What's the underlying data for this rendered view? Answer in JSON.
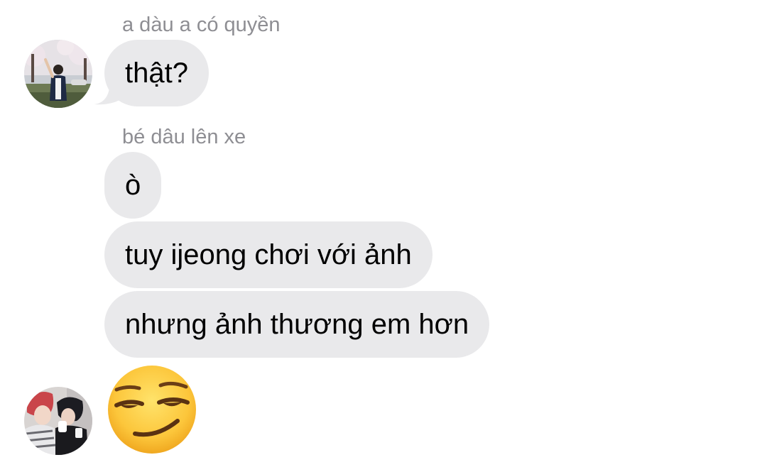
{
  "conversation": {
    "groups": [
      {
        "sender": "a dàu a có quyền",
        "messages": [
          "thật?"
        ],
        "avatar_icon": "photo-avatar-person-cherry-blossoms"
      },
      {
        "sender": "bé dâu lên xe",
        "messages": [
          "ò",
          "tuy ijeong chơi với ảnh",
          "nhưng ảnh thương em hơn"
        ],
        "avatar_icon": "photo-avatar-two-people",
        "emoji": "smirking-face"
      }
    ]
  },
  "colors": {
    "bubble_incoming": "#e9e9eb",
    "sender_label": "#8e8e93",
    "message_text": "#000000",
    "background": "#ffffff"
  }
}
